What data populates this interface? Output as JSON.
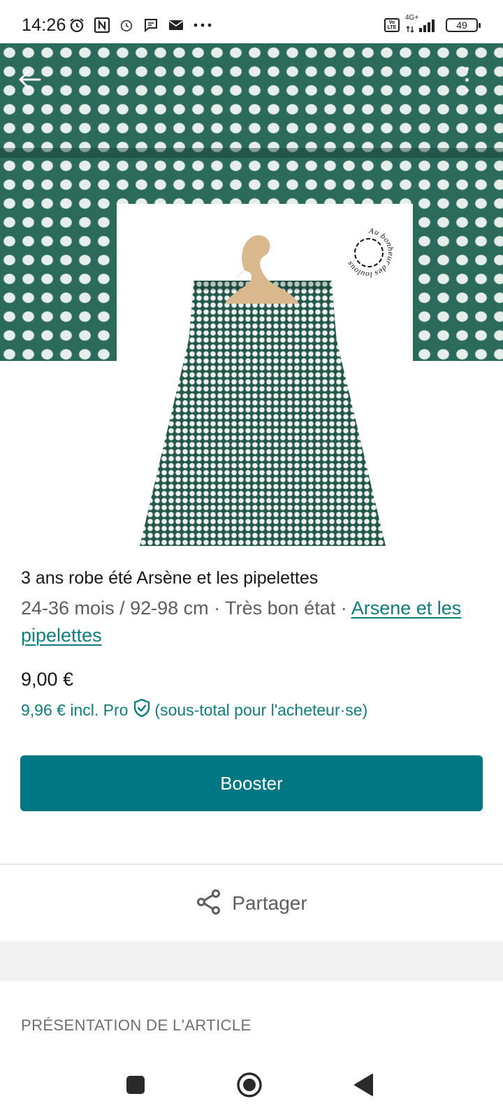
{
  "status_bar": {
    "time": "14:26",
    "network": "4G+",
    "battery": "49",
    "volte": "Vo LTE",
    "icons": [
      "alarm-icon",
      "nfc-icon",
      "alarm-icon",
      "chat-icon",
      "mail-icon",
      "more-icon"
    ]
  },
  "hero": {
    "logo_text": "Au bonheur des loulous"
  },
  "item": {
    "title": "3 ans robe été Arsène et les pipelettes",
    "meta_prefix": "24-36 mois / 92-98 cm · Très bon état · ",
    "brand": "Arsene et les pipelettes",
    "price": "9,00 €",
    "price_pro": "9,96 € incl. Pro",
    "price_pro_note": "(sous-total pour l'acheteur·se)"
  },
  "actions": {
    "booster": "Booster",
    "share": "Partager"
  },
  "section": {
    "title": "PRÉSENTATION DE L'ARTICLE"
  },
  "colors": {
    "accent": "#007782",
    "link": "#0c7e7e"
  }
}
